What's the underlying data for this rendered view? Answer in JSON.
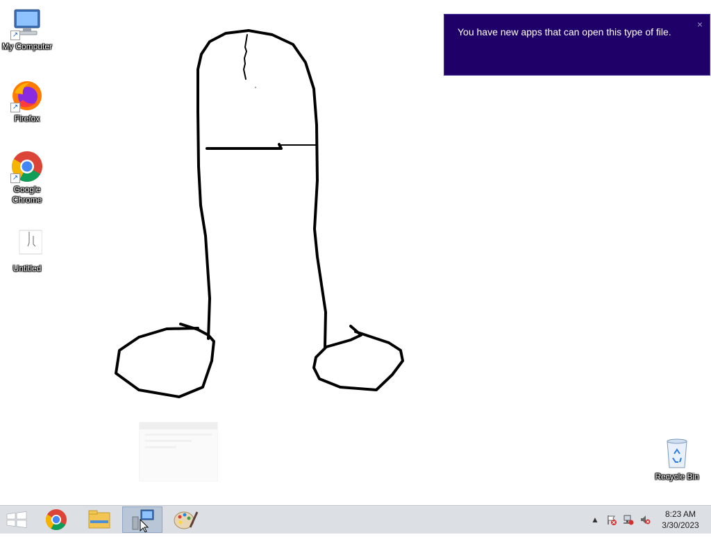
{
  "desktop": {
    "icons": [
      {
        "label": "My Computer",
        "icon": "computer-icon"
      },
      {
        "label": "Firefox",
        "icon": "firefox-icon"
      },
      {
        "label": "Google Chrome",
        "icon": "chrome-icon"
      },
      {
        "label": "Untitled",
        "icon": "paint-file-icon"
      },
      {
        "label": "Recycle Bin",
        "icon": "recycle-bin-icon"
      }
    ]
  },
  "toast": {
    "message": "You have new apps that can open this type of file.",
    "close": "×"
  },
  "taskbar": {
    "items": [
      "start-icon",
      "chrome-icon",
      "file-explorer-icon",
      "remote-desktop-icon",
      "paint-icon"
    ],
    "tray": [
      "show-hidden-icons-icon",
      "action-center-flag-icon",
      "network-icon",
      "volume-muted-icon"
    ],
    "time": "8:23 AM",
    "date": "3/30/2023"
  },
  "colors": {
    "toast_bg": "#1f0068",
    "taskbar_bg": "#dcdfe3"
  }
}
